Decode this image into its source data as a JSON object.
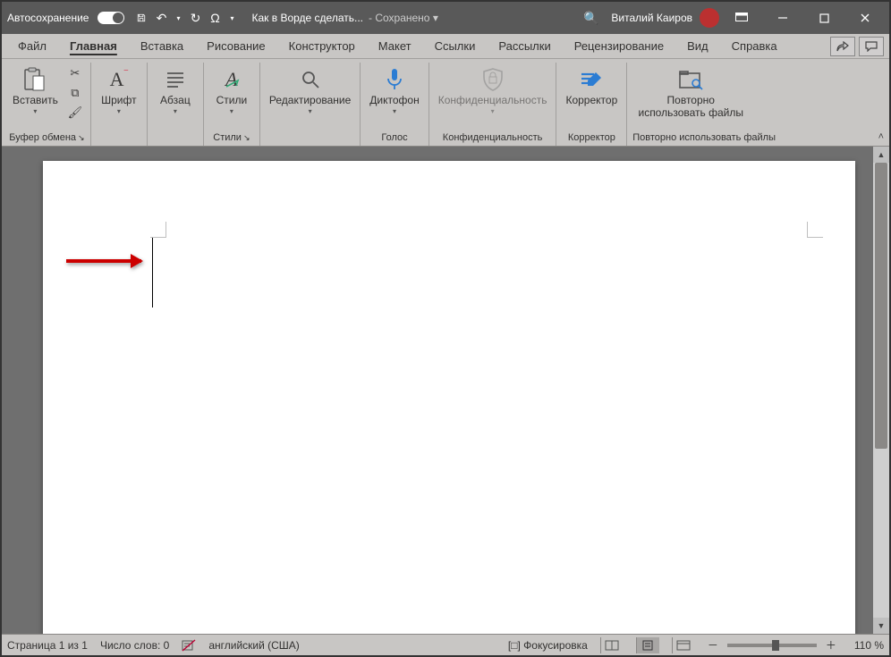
{
  "title_bar": {
    "autosave_label": "Автосохранение",
    "doc_title": "Как в Ворде сделать...",
    "saved_label": "- Сохранено",
    "user_name": "Виталий Каиров"
  },
  "tabs": {
    "items": [
      "Файл",
      "Главная",
      "Вставка",
      "Рисование",
      "Конструктор",
      "Макет",
      "Ссылки",
      "Рассылки",
      "Рецензирование",
      "Вид",
      "Справка"
    ],
    "active_index": 1
  },
  "ribbon": {
    "groups": [
      {
        "label": "Буфер обмена",
        "buttons": [
          {
            "label": "Вставить",
            "name": "paste",
            "icon": "📋"
          }
        ]
      },
      {
        "label": "",
        "buttons": [
          {
            "label": "Шрифт",
            "name": "font",
            "icon": "A"
          }
        ]
      },
      {
        "label": "",
        "buttons": [
          {
            "label": "Абзац",
            "name": "paragraph",
            "icon": "≣"
          }
        ]
      },
      {
        "label": "Стили",
        "buttons": [
          {
            "label": "Стили",
            "name": "styles",
            "icon": "A"
          }
        ]
      },
      {
        "label": "",
        "buttons": [
          {
            "label": "Редактирование",
            "name": "editing",
            "icon": "🔍"
          }
        ]
      },
      {
        "label": "Голос",
        "buttons": [
          {
            "label": "Диктофон",
            "name": "dictate",
            "icon": "🎤"
          }
        ]
      },
      {
        "label": "Конфиденциальность",
        "buttons": [
          {
            "label": "Конфиденциальность",
            "name": "sensitivity",
            "icon": "🛡"
          }
        ]
      },
      {
        "label": "Корректор",
        "buttons": [
          {
            "label": "Корректор",
            "name": "editor",
            "icon": "✎"
          }
        ]
      },
      {
        "label": "Повторно использовать файлы",
        "buttons": [
          {
            "label": "Повторно\nиспользовать файлы",
            "name": "reuse-files",
            "icon": "🗂"
          }
        ]
      }
    ]
  },
  "status": {
    "page": "Страница 1 из 1",
    "words": "Число слов: 0",
    "lang": "английский (США)",
    "focus": "Фокусировка",
    "zoom": "110 %"
  }
}
